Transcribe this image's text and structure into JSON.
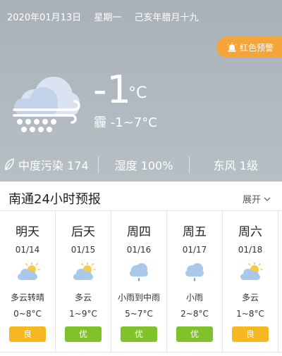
{
  "header": {
    "date": "2020年01月13日",
    "weekday": "星期一",
    "lunar": "己亥年腊月十九",
    "alert_label": "红色预警",
    "alert_color": "#f5a43a"
  },
  "current": {
    "temperature": "-1",
    "unit": "°C",
    "condition": "霾 -1~7°C",
    "icon": "cloud-snow-icon"
  },
  "stats": {
    "pollution": "中度污染 174",
    "humidity": "湿度 100%",
    "wind": "东风 1级"
  },
  "forecast": {
    "title": "南通24小时预报",
    "expand_label": "展开",
    "days": [
      {
        "name": "明天",
        "date": "01/14",
        "icon": "partly-cloudy-icon",
        "desc": "多云转晴",
        "range": "0~8°C",
        "aqi": "良"
      },
      {
        "name": "后天",
        "date": "01/15",
        "icon": "partly-cloudy-icon",
        "desc": "多云",
        "range": "1~9°C",
        "aqi": "优"
      },
      {
        "name": "周四",
        "date": "01/16",
        "icon": "rain-icon",
        "desc": "小雨到中雨",
        "range": "5~7°C",
        "aqi": "优"
      },
      {
        "name": "周五",
        "date": "01/17",
        "icon": "rain-icon",
        "desc": "小雨",
        "range": "2~8°C",
        "aqi": "优"
      },
      {
        "name": "周六",
        "date": "01/18",
        "icon": "partly-cloudy-icon",
        "desc": "多云",
        "range": "1~8°C",
        "aqi": "良"
      }
    ]
  },
  "colors": {
    "aqi_good": "#7fc22a",
    "aqi_moderate": "#f5b820"
  }
}
